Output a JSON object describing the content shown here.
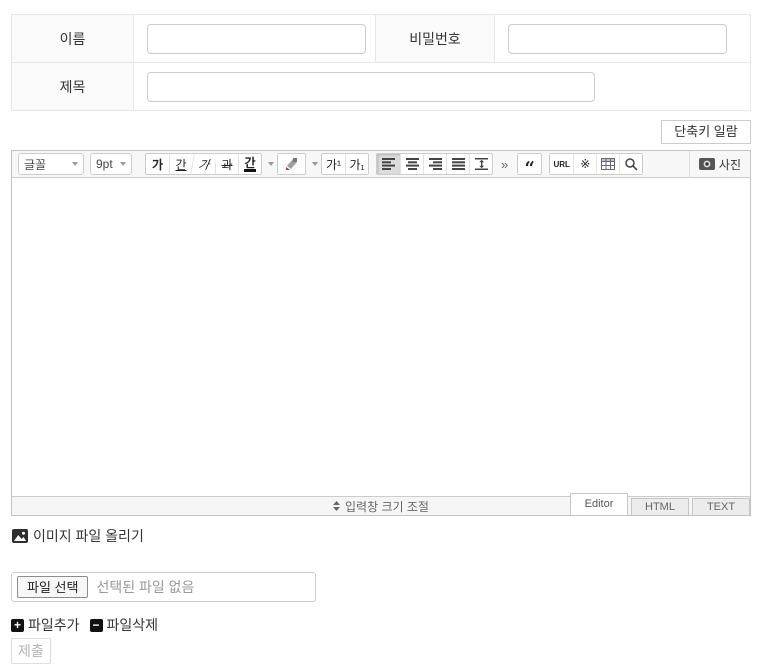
{
  "form": {
    "name_label": "이름",
    "password_label": "비밀번호",
    "title_label": "제목",
    "name_value": "",
    "password_value": "",
    "title_value": ""
  },
  "shortcut_button_label": "단축키 일람",
  "editor": {
    "toolbar": {
      "font_family": "글꼴",
      "font_size": "9pt",
      "bold": "가",
      "underline": "간",
      "italic": "가",
      "strikethrough": "과",
      "font_color": "간",
      "superscript": "가¹",
      "subscript": "가₁",
      "more": "»",
      "quote": "“",
      "url": "URL",
      "special_char": "※",
      "photo": "사진"
    },
    "resize_label": "입력창 크기 조절",
    "tabs": [
      "Editor",
      "HTML",
      "TEXT"
    ],
    "active_tab": "Editor"
  },
  "attachments": {
    "image_upload_label": "이미지 파일 올리기",
    "file_select_button": "파일 선택",
    "file_status": "선택된 파일 없음",
    "add_file_label": "파일추가",
    "delete_file_label": "파일삭제",
    "submit_label": "제출"
  },
  "colors": {
    "label_cell_bg": "#fafafa",
    "toolbar_bg": "#f7f7f7",
    "border": "#cccccc",
    "pressed_button_bg": "#dcdcdc",
    "muted_text": "#999999"
  }
}
